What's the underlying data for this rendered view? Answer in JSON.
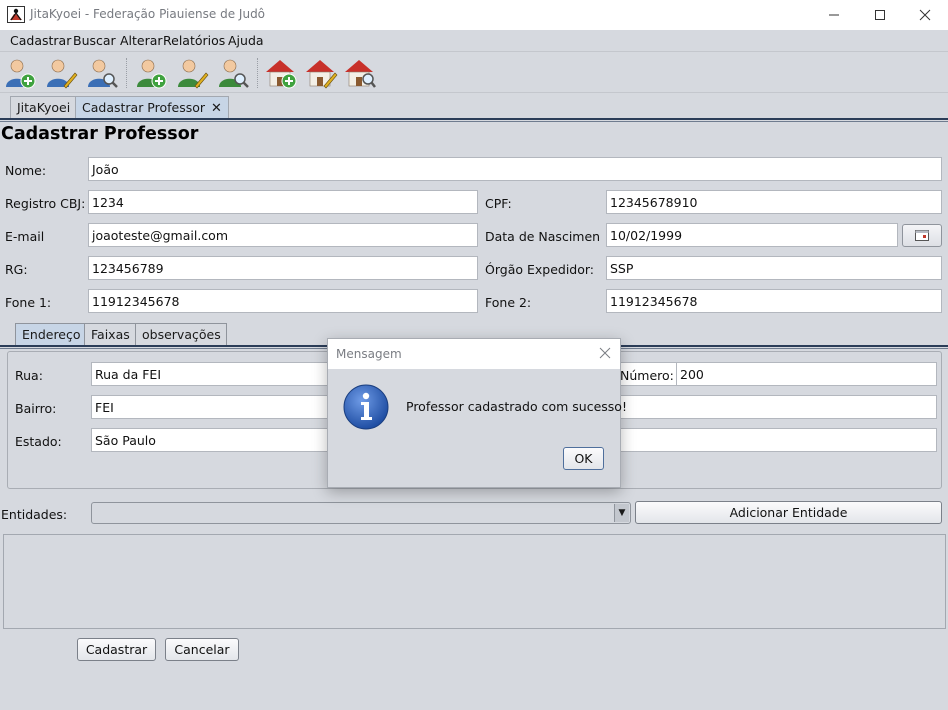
{
  "window": {
    "title": "JitaKyoei - Federação Piauiense de Judô"
  },
  "menu": [
    "Cadastrar",
    "Buscar",
    "Alterar",
    "Relatórios",
    "Ajuda"
  ],
  "tabs": [
    {
      "label": "JitaKyoei"
    },
    {
      "label": "Cadastrar Professor"
    }
  ],
  "form": {
    "title": "Cadastrar Professor",
    "nome_label": "Nome:",
    "nome": "João",
    "registro_label": "Registro CBJ:",
    "registro": "1234",
    "cpf_label": "CPF:",
    "cpf": "12345678910",
    "email_label": "E-mail",
    "email": "joaoteste@gmail.com",
    "nascimento_label": "Data de Nascimen...",
    "nascimento": "10/02/1999",
    "rg_label": "RG:",
    "rg": "123456789",
    "orgao_label": "Órgão Expedidor:",
    "orgao": "SSP",
    "fone1_label": "Fone 1:",
    "fone1": "11912345678",
    "fone2_label": "Fone 2:",
    "fone2": "11912345678"
  },
  "subtabs": [
    "Endereço",
    "Faixas",
    "observações"
  ],
  "endereco": {
    "rua_label": "Rua:",
    "rua": "Rua da FEI",
    "numero_label": "Número:",
    "numero": "200",
    "bairro_label": "Bairro:",
    "bairro": "FEI",
    "estado_label": "Estado:",
    "estado": "São Paulo"
  },
  "entidades": {
    "label": "Entidades:",
    "add_button": "Adicionar Entidade"
  },
  "actions": {
    "cadastrar": "Cadastrar",
    "cancelar": "Cancelar"
  },
  "dialog": {
    "title": "Mensagem",
    "message": "Professor cadastrado com sucesso!",
    "ok": "OK"
  }
}
